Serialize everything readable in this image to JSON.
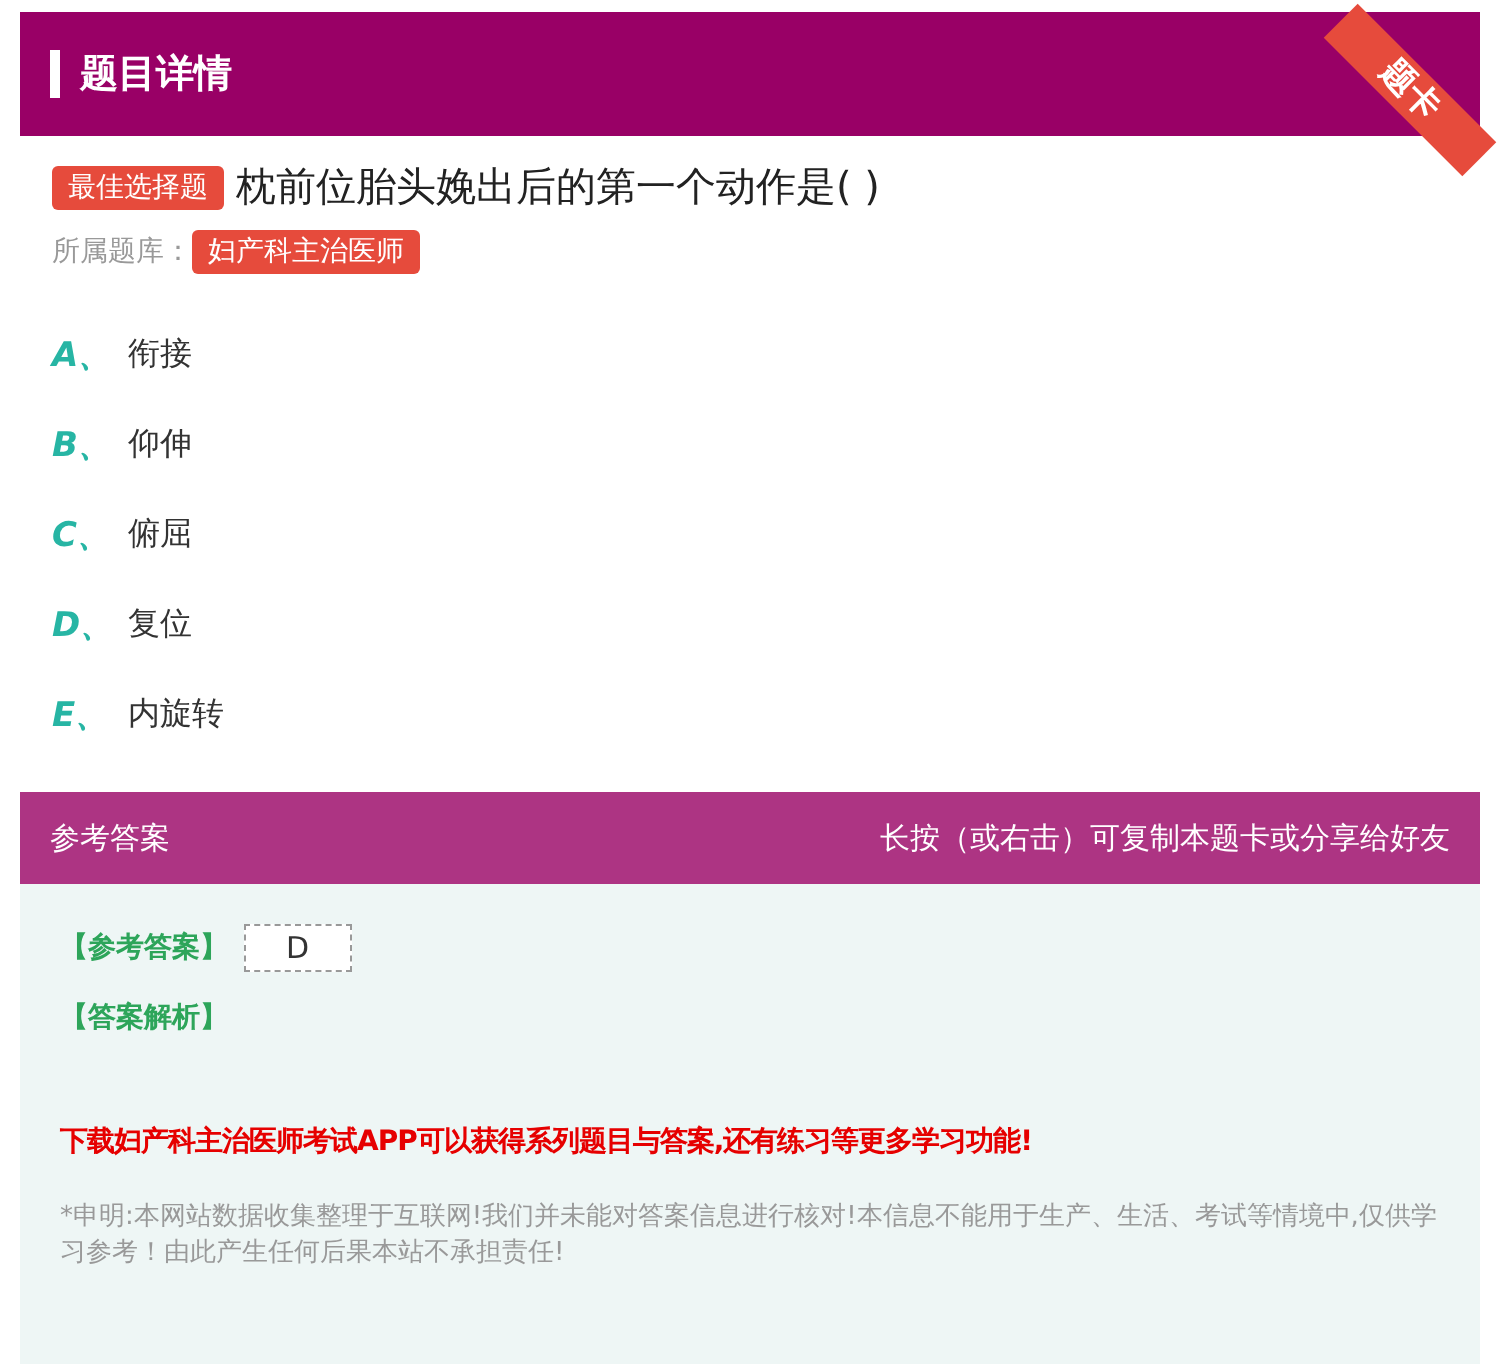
{
  "header": {
    "title": "题目详情",
    "corner_ribbon": "题卡"
  },
  "question": {
    "type_badge": "最佳选择题",
    "text": "枕前位胎头娩出后的第一个动作是( )",
    "bank_label": "所属题库：",
    "bank": "妇产科主治医师"
  },
  "options": [
    {
      "letter": "A",
      "separator": "、",
      "text": "衔接"
    },
    {
      "letter": "B",
      "separator": "、",
      "text": "仰伸"
    },
    {
      "letter": "C",
      "separator": "、",
      "text": "俯屈"
    },
    {
      "letter": "D",
      "separator": "、",
      "text": "复位"
    },
    {
      "letter": "E",
      "separator": "、",
      "text": "内旋转"
    }
  ],
  "answer_panel": {
    "title": "参考答案",
    "hint": "长按（或右击）可复制本题卡或分享给好友",
    "answer_label": "【参考答案】",
    "answer": "D",
    "analysis_label": "【答案解析】",
    "promo": "下载妇产科主治医师考试APP可以获得系列题目与答案,还有练习等更多学习功能!",
    "disclaimer": "*申明:本网站数据收集整理于互联网!我们并未能对答案信息进行核对!本信息不能用于生产、生活、考试等情境中,仅供学习参考！由此产生任何后果本站不承担责任!"
  }
}
